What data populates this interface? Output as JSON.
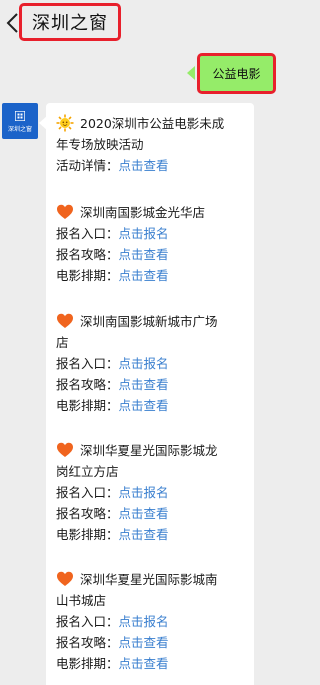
{
  "header": {
    "title": "深圳之窗"
  },
  "user_message": {
    "text": "公益电影"
  },
  "avatar": {
    "label": "深圳之窗"
  },
  "sections": [
    {
      "title_l1": "2020深圳市公益电影未成",
      "title_l2": "年专场放映活动",
      "emoji": "sun-icon",
      "rows": [
        {
          "label": "活动详情：",
          "link": "点击查看"
        }
      ]
    },
    {
      "title_l1": "深圳南国影城金光华店",
      "title_l2": "",
      "emoji": "heart-icon",
      "rows": [
        {
          "label": "报名入口：",
          "link": "点击报名"
        },
        {
          "label": "报名攻略：",
          "link": "点击查看"
        },
        {
          "label": "电影排期：",
          "link": "点击查看"
        }
      ]
    },
    {
      "title_l1": "深圳南国影城新城市广场",
      "title_l2": "店",
      "emoji": "heart-icon",
      "rows": [
        {
          "label": "报名入口：",
          "link": "点击报名"
        },
        {
          "label": "报名攻略：",
          "link": "点击查看"
        },
        {
          "label": "电影排期：",
          "link": "点击查看"
        }
      ]
    },
    {
      "title_l1": "深圳华夏星光国际影城龙",
      "title_l2": "岗红立方店",
      "emoji": "heart-icon",
      "rows": [
        {
          "label": "报名入口：",
          "link": "点击报名"
        },
        {
          "label": "报名攻略：",
          "link": "点击查看"
        },
        {
          "label": "电影排期：",
          "link": "点击查看"
        }
      ]
    },
    {
      "title_l1": "深圳华夏星光国际影城南",
      "title_l2": "山书城店",
      "emoji": "heart-icon",
      "rows": [
        {
          "label": "报名入口：",
          "link": "点击报名"
        },
        {
          "label": "报名攻略：",
          "link": "点击查看"
        },
        {
          "label": "电影排期：",
          "link": "点击查看"
        }
      ]
    }
  ],
  "colors": {
    "accent_red": "#e8202c",
    "link": "#3a7fcf",
    "bubble_green": "#95ec69",
    "avatar_blue": "#1b63c9"
  }
}
